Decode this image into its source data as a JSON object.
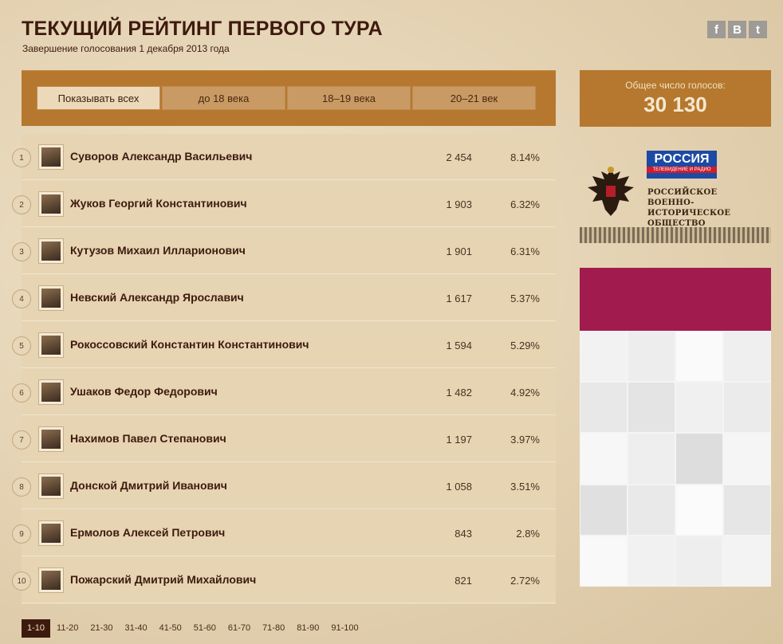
{
  "header": {
    "title": "ТЕКУЩИЙ РЕЙТИНГ ПЕРВОГО ТУРА",
    "subtitle": "Завершение голосования 1 декабря 2013 года"
  },
  "social": {
    "facebook": "f",
    "vk": "B",
    "twitter": "t"
  },
  "filters": [
    "Показывать всех",
    "до 18 века",
    "18–19 века",
    "20–21 век"
  ],
  "total": {
    "label": "Общее число голосов:",
    "value": "30 130"
  },
  "sponsors": {
    "rossiya_title": "РОССИЯ",
    "rossiya_sub": "ТЕЛЕВИДЕНИЕ И РАДИО",
    "rvio": [
      "РОССИЙСКОЕ",
      "ВОЕННО-ИСТОРИЧЕСКОЕ",
      "ОБЩЕСТВО"
    ]
  },
  "ranking": [
    {
      "num": "1",
      "name": "Суворов Александр Васильевич",
      "votes": "2 454",
      "pct": "8.14%"
    },
    {
      "num": "2",
      "name": "Жуков Георгий Константинович",
      "votes": "1 903",
      "pct": "6.32%"
    },
    {
      "num": "3",
      "name": "Кутузов Михаил Илларионович",
      "votes": "1 901",
      "pct": "6.31%"
    },
    {
      "num": "4",
      "name": "Невский Александр Ярославич",
      "votes": "1 617",
      "pct": "5.37%"
    },
    {
      "num": "5",
      "name": "Рокоссовский Константин Константинович",
      "votes": "1 594",
      "pct": "5.29%"
    },
    {
      "num": "6",
      "name": "Ушаков Федор Федорович",
      "votes": "1 482",
      "pct": "4.92%"
    },
    {
      "num": "7",
      "name": "Нахимов Павел Степанович",
      "votes": "1 197",
      "pct": "3.97%"
    },
    {
      "num": "8",
      "name": "Донской Дмитрий Иванович",
      "votes": "1 058",
      "pct": "3.51%"
    },
    {
      "num": "9",
      "name": "Ермолов Алексей Петрович",
      "votes": "843",
      "pct": "2.8%"
    },
    {
      "num": "10",
      "name": "Пожарский Дмитрий Михайлович",
      "votes": "821",
      "pct": "2.72%"
    }
  ],
  "pagination": [
    "1-10",
    "11-20",
    "21-30",
    "31-40",
    "41-50",
    "51-60",
    "61-70",
    "71-80",
    "81-90",
    "91-100"
  ]
}
